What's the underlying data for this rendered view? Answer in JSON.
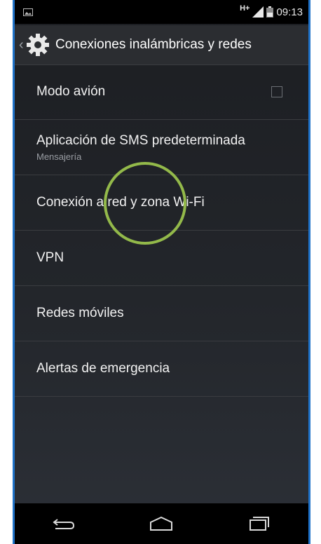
{
  "status_bar": {
    "network": "H+",
    "time": "09:13"
  },
  "action_bar": {
    "title": "Conexiones inalámbricas y redes",
    "icon": "settings-gear-icon"
  },
  "settings": [
    {
      "title": "Modo avión",
      "subtitle": "",
      "checkbox": false
    },
    {
      "title": "Aplicación de SMS predeterminada",
      "subtitle": "Mensajería"
    },
    {
      "title": "Conexión a red y zona Wi-Fi",
      "subtitle": ""
    },
    {
      "title": "VPN",
      "subtitle": ""
    },
    {
      "title": "Redes móviles",
      "subtitle": ""
    },
    {
      "title": "Alertas de emergencia",
      "subtitle": ""
    }
  ],
  "nav": {
    "back": "back-icon",
    "home": "home-icon",
    "recents": "recents-icon"
  },
  "colors": {
    "frame": "#1f72c8",
    "highlight_circle": "#93b94a",
    "background": "#1c1e22"
  }
}
